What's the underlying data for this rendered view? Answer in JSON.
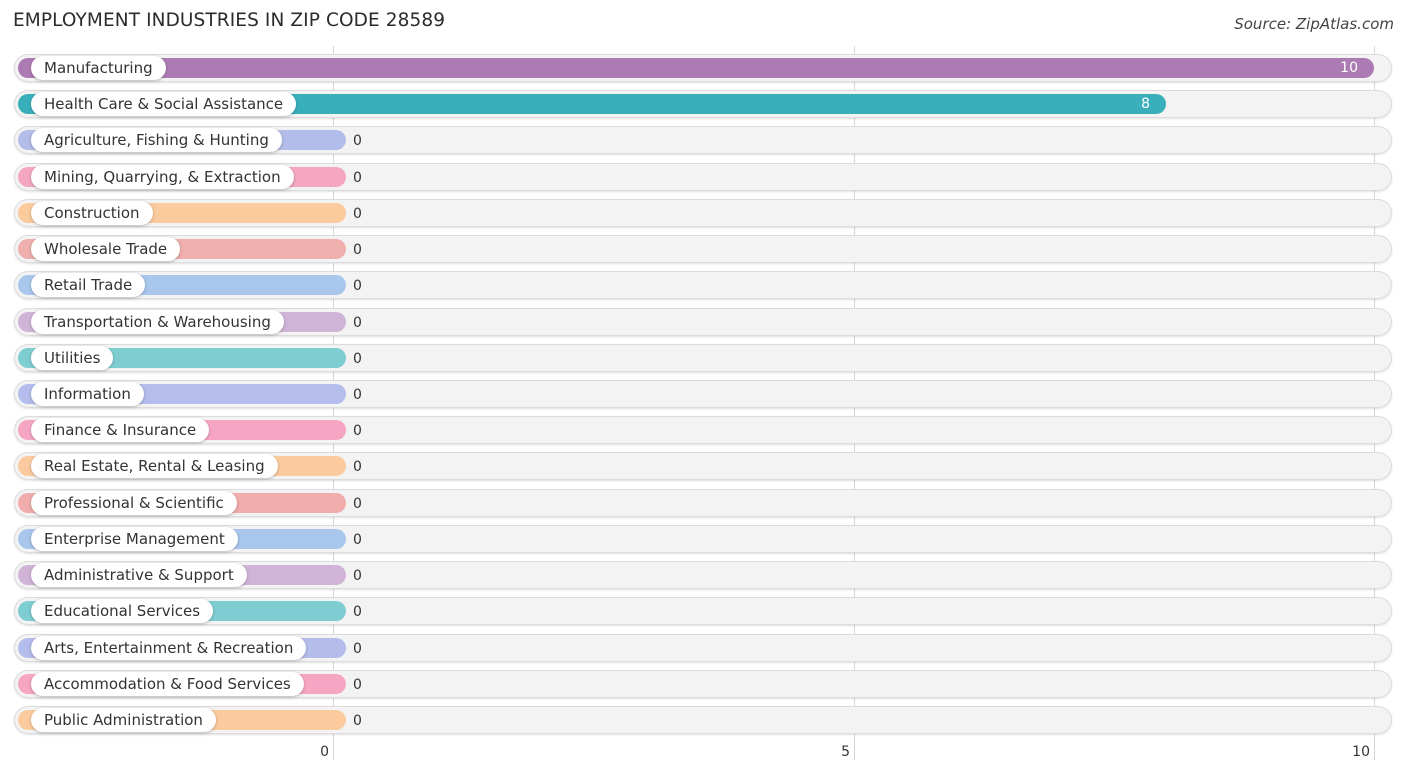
{
  "header": {
    "title": "EMPLOYMENT INDUSTRIES IN ZIP CODE 28589",
    "source": "Source: ZipAtlas.com"
  },
  "chart_data": {
    "type": "bar",
    "orientation": "horizontal",
    "title": "EMPLOYMENT INDUSTRIES IN ZIP CODE 28589",
    "xlabel": "",
    "ylabel": "",
    "xlim": [
      0,
      10
    ],
    "xticks": [
      0,
      5,
      10
    ],
    "xtick_labels": [
      "0",
      "5",
      "10"
    ],
    "grid": true,
    "categories": [
      "Manufacturing",
      "Health Care & Social Assistance",
      "Agriculture, Fishing & Hunting",
      "Mining, Quarrying, & Extraction",
      "Construction",
      "Wholesale Trade",
      "Retail Trade",
      "Transportation & Warehousing",
      "Utilities",
      "Information",
      "Finance & Insurance",
      "Real Estate, Rental & Leasing",
      "Professional & Scientific",
      "Enterprise Management",
      "Administrative & Support",
      "Educational Services",
      "Arts, Entertainment & Recreation",
      "Accommodation & Food Services",
      "Public Administration"
    ],
    "values": [
      10,
      8,
      0,
      0,
      0,
      0,
      0,
      0,
      0,
      0,
      0,
      0,
      0,
      0,
      0,
      0,
      0,
      0,
      0
    ],
    "value_labels": [
      "10",
      "8",
      "0",
      "0",
      "0",
      "0",
      "0",
      "0",
      "0",
      "0",
      "0",
      "0",
      "0",
      "0",
      "0",
      "0",
      "0",
      "0",
      "0"
    ],
    "colors": [
      "#ad7bb3",
      "#3aafbc",
      "#b3bdea",
      "#f5a7c2",
      "#fbcb9e",
      "#efafad",
      "#a9c7ec",
      "#d0b4d7",
      "#7ecdd1",
      "#b4bdec",
      "#f6a6c3",
      "#fbca9f",
      "#f0adab",
      "#a9c6ec",
      "#d0b3d6",
      "#7ecdd3",
      "#b4bcec",
      "#f6a6c2",
      "#fbcb9f"
    ]
  }
}
